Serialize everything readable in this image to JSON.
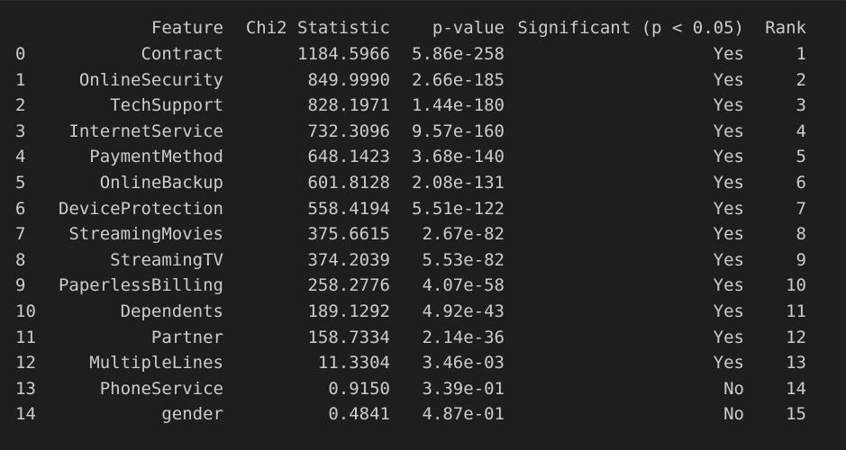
{
  "table": {
    "headers": {
      "index": "",
      "feature": "Feature",
      "chi2": "Chi2 Statistic",
      "pvalue": "p-value",
      "significant": "Significant (p < 0.05)",
      "rank": "Rank"
    },
    "rows": [
      {
        "index": "0",
        "feature": "Contract",
        "chi2": "1184.5966",
        "pvalue": "5.86e-258",
        "significant": "Yes",
        "rank": "1"
      },
      {
        "index": "1",
        "feature": "OnlineSecurity",
        "chi2": "849.9990",
        "pvalue": "2.66e-185",
        "significant": "Yes",
        "rank": "2"
      },
      {
        "index": "2",
        "feature": "TechSupport",
        "chi2": "828.1971",
        "pvalue": "1.44e-180",
        "significant": "Yes",
        "rank": "3"
      },
      {
        "index": "3",
        "feature": "InternetService",
        "chi2": "732.3096",
        "pvalue": "9.57e-160",
        "significant": "Yes",
        "rank": "4"
      },
      {
        "index": "4",
        "feature": "PaymentMethod",
        "chi2": "648.1423",
        "pvalue": "3.68e-140",
        "significant": "Yes",
        "rank": "5"
      },
      {
        "index": "5",
        "feature": "OnlineBackup",
        "chi2": "601.8128",
        "pvalue": "2.08e-131",
        "significant": "Yes",
        "rank": "6"
      },
      {
        "index": "6",
        "feature": "DeviceProtection",
        "chi2": "558.4194",
        "pvalue": "5.51e-122",
        "significant": "Yes",
        "rank": "7"
      },
      {
        "index": "7",
        "feature": "StreamingMovies",
        "chi2": "375.6615",
        "pvalue": "2.67e-82",
        "significant": "Yes",
        "rank": "8"
      },
      {
        "index": "8",
        "feature": "StreamingTV",
        "chi2": "374.2039",
        "pvalue": "5.53e-82",
        "significant": "Yes",
        "rank": "9"
      },
      {
        "index": "9",
        "feature": "PaperlessBilling",
        "chi2": "258.2776",
        "pvalue": "4.07e-58",
        "significant": "Yes",
        "rank": "10"
      },
      {
        "index": "10",
        "feature": "Dependents",
        "chi2": "189.1292",
        "pvalue": "4.92e-43",
        "significant": "Yes",
        "rank": "11"
      },
      {
        "index": "11",
        "feature": "Partner",
        "chi2": "158.7334",
        "pvalue": "2.14e-36",
        "significant": "Yes",
        "rank": "12"
      },
      {
        "index": "12",
        "feature": "MultipleLines",
        "chi2": "11.3304",
        "pvalue": "3.46e-03",
        "significant": "Yes",
        "rank": "13"
      },
      {
        "index": "13",
        "feature": "PhoneService",
        "chi2": "0.9150",
        "pvalue": "3.39e-01",
        "significant": "No",
        "rank": "14"
      },
      {
        "index": "14",
        "feature": "gender",
        "chi2": "0.4841",
        "pvalue": "4.87e-01",
        "significant": "No",
        "rank": "15"
      }
    ]
  },
  "colors": {
    "background": "#1e1e1e",
    "text": "#cccccc"
  }
}
